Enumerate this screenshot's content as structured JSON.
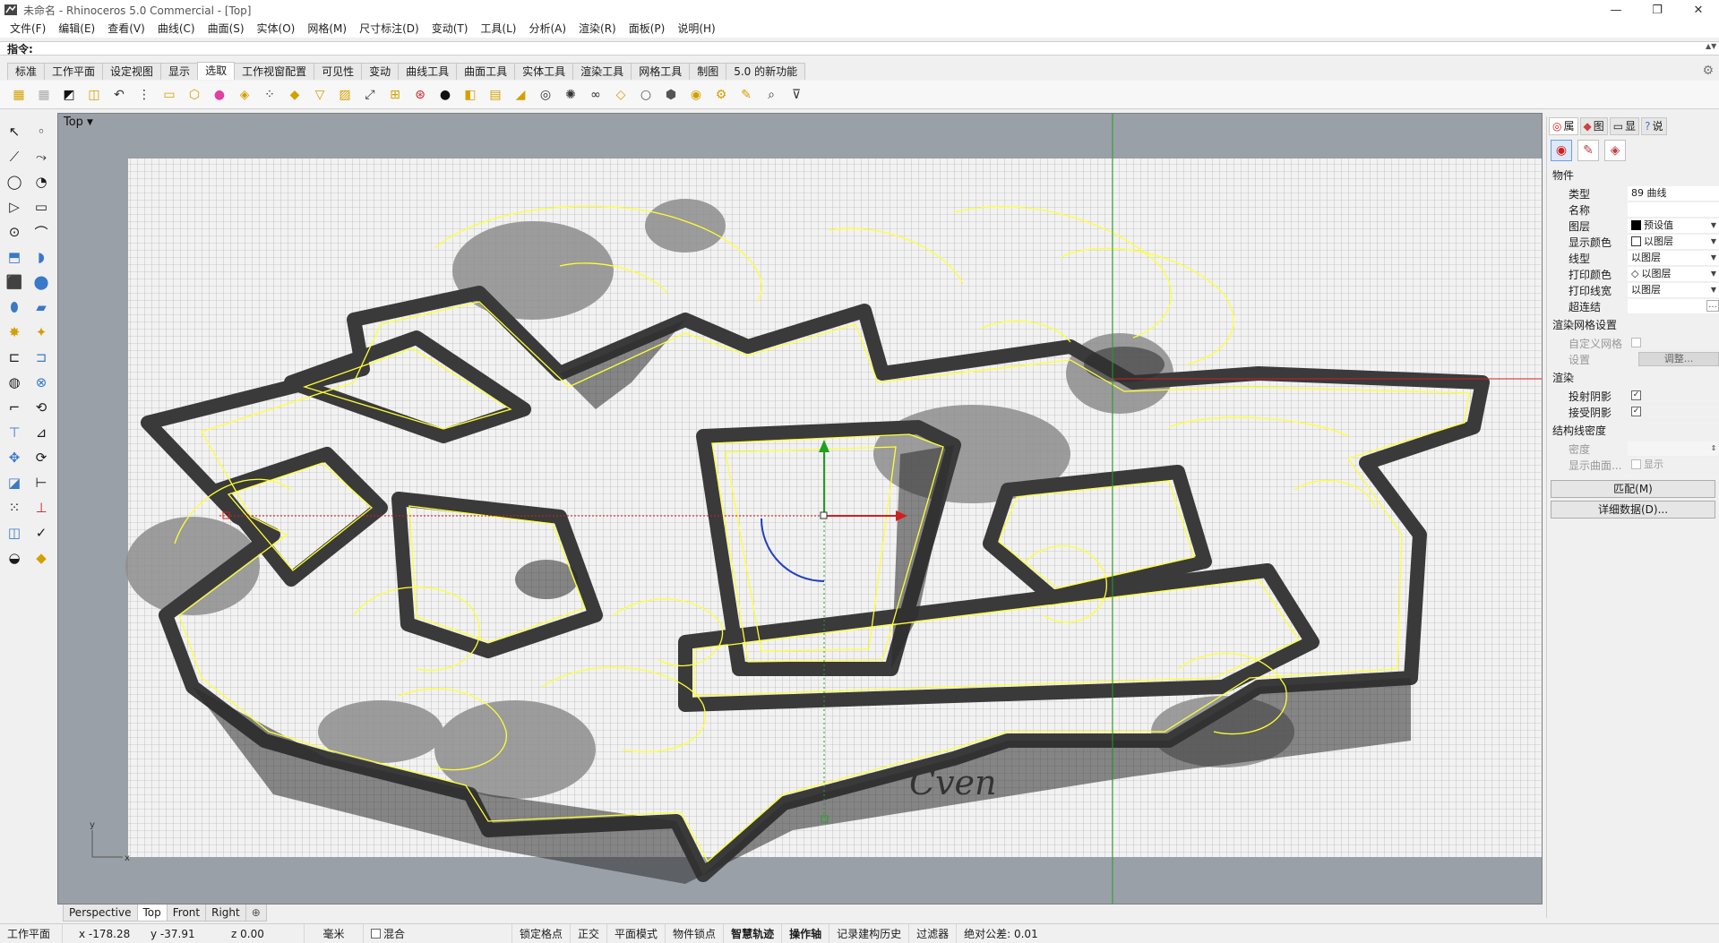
{
  "window": {
    "title": "未命名 - Rhinoceros 5.0 Commercial - [Top]",
    "controls": [
      "—",
      "❐",
      "✕"
    ]
  },
  "menu": [
    "文件(F)",
    "编辑(E)",
    "查看(V)",
    "曲线(C)",
    "曲面(S)",
    "实体(O)",
    "网格(M)",
    "尺寸标注(D)",
    "变动(T)",
    "工具(L)",
    "分析(A)",
    "渲染(R)",
    "面板(P)",
    "说明(H)"
  ],
  "command": {
    "prompt": "指令:",
    "value": ""
  },
  "toolbar_tabs": {
    "items": [
      "标准",
      "工作平面",
      "设定视图",
      "显示",
      "选取",
      "工作视窗配置",
      "可见性",
      "变动",
      "曲线工具",
      "曲面工具",
      "实体工具",
      "渲染工具",
      "网格工具",
      "制图",
      "5.0 的新功能"
    ],
    "active": "选取"
  },
  "viewport": {
    "label": "Top",
    "axis_y": "y",
    "axis_x": "x",
    "signature": "Cven"
  },
  "viewport_tabs": {
    "items": [
      "Perspective",
      "Top",
      "Front",
      "Right"
    ],
    "active": "Top",
    "add": "⊕"
  },
  "panel": {
    "tabs": [
      "属",
      "图",
      "显",
      "说"
    ],
    "section_object": "物件",
    "props": {
      "type_label": "类型",
      "type_value": "89 曲线",
      "name_label": "名称",
      "name_value": "",
      "layer_label": "图层",
      "layer_value": "预设值",
      "display_color_label": "显示颜色",
      "display_color_value": "以图层",
      "linetype_label": "线型",
      "linetype_value": "以图层",
      "print_color_label": "打印颜色",
      "print_color_value": "以图层",
      "print_width_label": "打印线宽",
      "print_width_value": "以图层",
      "hyperlink_label": "超连结",
      "hyperlink_button": "..."
    },
    "section_mesh": "渲染网格设置",
    "custom_mesh_label": "自定义网格",
    "settings_label": "设置",
    "adjust_button": "调整...",
    "section_render": "渲染",
    "cast_shadow_label": "投射阴影",
    "receive_shadow_label": "接受阴影",
    "section_isocurve": "结构线密度",
    "density_label": "密度",
    "show_surface_label": "显示曲面...",
    "show_label": "显示",
    "match_button": "匹配(M)",
    "details_button": "详细数据(D)..."
  },
  "status": {
    "cplane": "工作平面",
    "x": "x -178.28",
    "y": "y -37.91",
    "z": "z 0.00",
    "unit": "毫米",
    "layer_mix": "混合",
    "grid_snap": "锁定格点",
    "ortho": "正交",
    "planar": "平面模式",
    "osnap": "物件锁点",
    "smarttrack": "智慧轨迹",
    "gumball": "操作轴",
    "history": "记录建构历史",
    "filter": "过滤器",
    "tolerance": "绝对公差: 0.01"
  },
  "colors": {
    "viewport_bg": "#9aa0a8",
    "grid_paper": "#f2f2f2",
    "curve": "#ffff33",
    "axis_red": "#d02020",
    "axis_green": "#20a020"
  }
}
